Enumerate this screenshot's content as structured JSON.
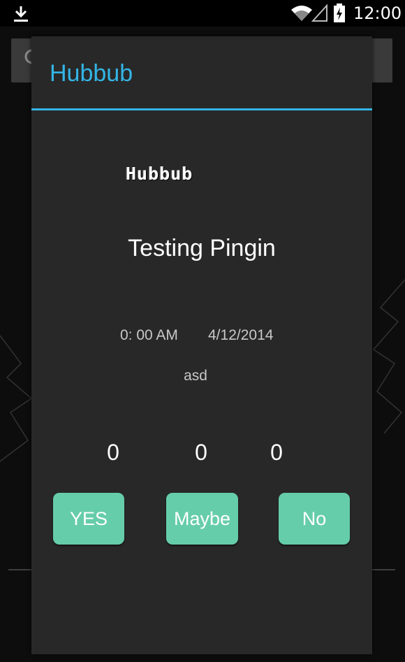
{
  "status_bar": {
    "time": "12:00",
    "icons": [
      "download-icon",
      "wifi-icon",
      "signal-icon",
      "battery-charging-icon"
    ]
  },
  "background": {
    "icons": [
      "search-icon",
      "leaf-icon"
    ]
  },
  "dialog": {
    "title": "Hubbub",
    "logo_text": "Hubbub",
    "event_name": "Testing Pingin",
    "time": "0: 00 AM",
    "date": "4/12/2014",
    "description": "asd",
    "counts": {
      "yes": "0",
      "maybe": "0",
      "no": "0"
    },
    "buttons": {
      "yes": "YES",
      "maybe": "Maybe",
      "no": "No"
    }
  },
  "colors": {
    "accent": "#33b5e5",
    "button": "#66cdaa",
    "dialog_bg": "#282828"
  }
}
